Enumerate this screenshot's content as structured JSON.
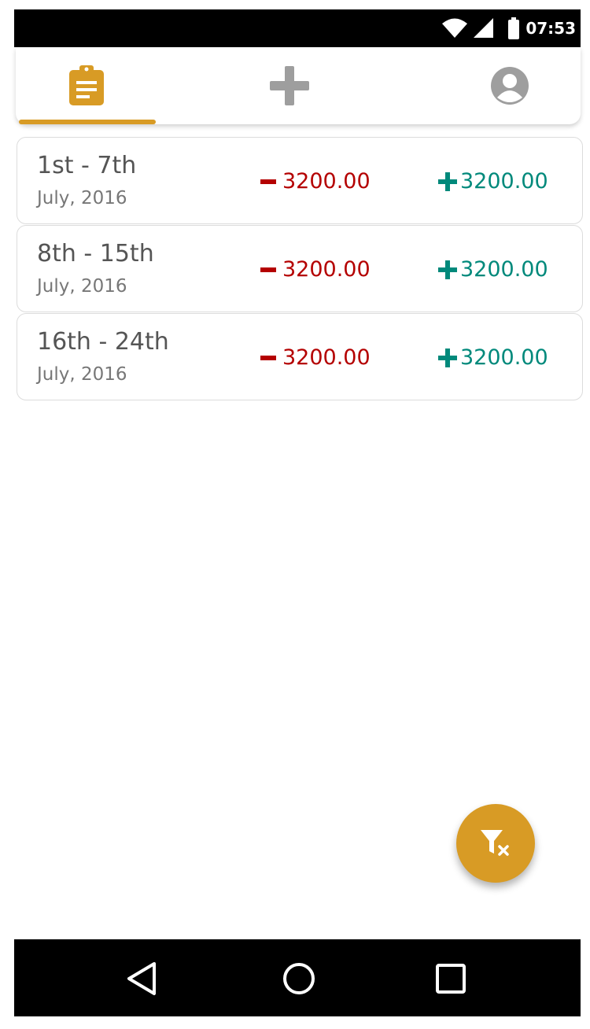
{
  "status_bar": {
    "time": "07:53",
    "icons": [
      "wifi-icon",
      "signal-icon",
      "battery-icon"
    ]
  },
  "tabs": [
    {
      "name": "entries",
      "icon": "clipboard-icon",
      "active": true
    },
    {
      "name": "add",
      "icon": "plus-icon",
      "active": false
    },
    {
      "name": "profile",
      "icon": "account-icon",
      "active": false
    }
  ],
  "entries": [
    {
      "range": "1st - 7th",
      "month": "July, 2016",
      "expense": "3200.00",
      "income": "3200.00"
    },
    {
      "range": "8th - 15th",
      "month": "July, 2016",
      "expense": "3200.00",
      "income": "3200.00"
    },
    {
      "range": "16th - 24th",
      "month": "July, 2016",
      "expense": "3200.00",
      "income": "3200.00"
    }
  ],
  "fab": {
    "icon": "filter-clear-icon"
  },
  "nav": {
    "icons": [
      "back-icon",
      "home-icon",
      "recents-icon"
    ]
  },
  "colors": {
    "accent": "#D89B25",
    "expense": "#B40000",
    "income": "#00897B",
    "inactive_icon": "#9E9E9E"
  }
}
